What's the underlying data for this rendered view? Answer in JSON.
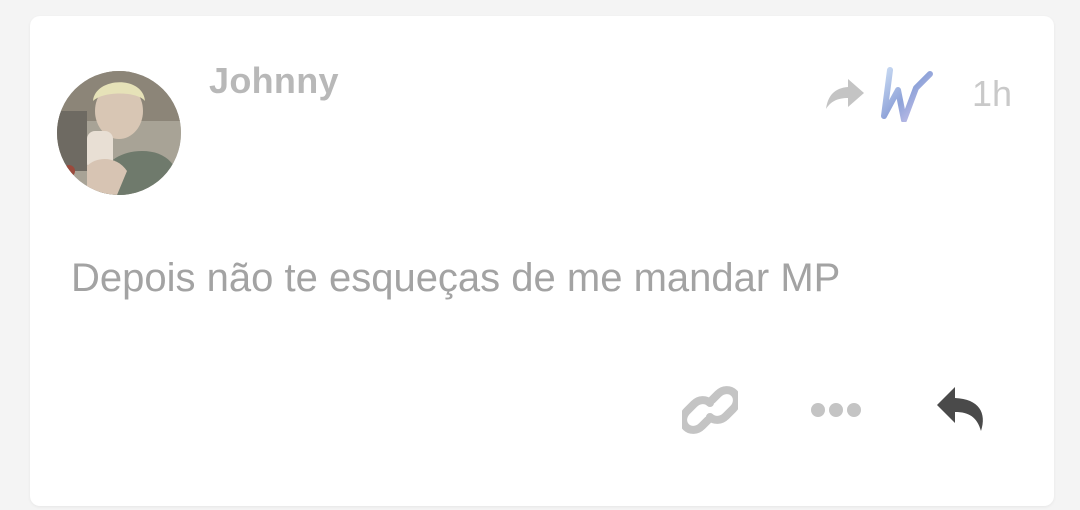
{
  "post": {
    "author": "Johnny",
    "timestamp": "1h",
    "body": "Depois não te esqueças de me mandar MP"
  },
  "icons": {
    "share": "share-arrow-icon",
    "badge": "w-badge-icon",
    "link": "link-icon",
    "more": "more-horizontal-icon",
    "reply": "reply-icon"
  },
  "colors": {
    "text_muted": "#a3a3a3",
    "username": "#b8b8b8",
    "icon_light": "#c4c4c4",
    "icon_dark": "#4a4a4a"
  }
}
